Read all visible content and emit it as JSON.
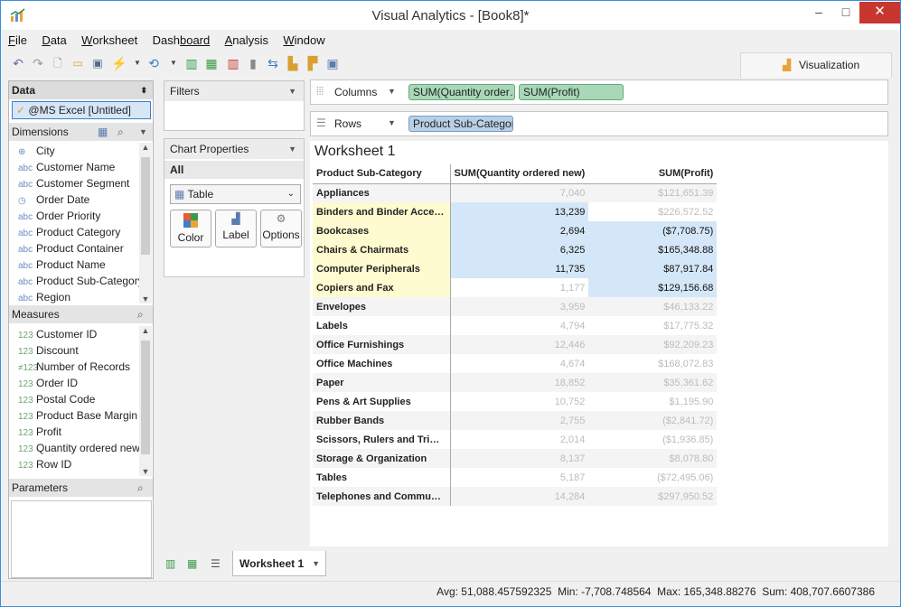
{
  "window": {
    "title": "Visual Analytics - [Book8]*",
    "min": "–",
    "max": "□",
    "close": "✕"
  },
  "menu": [
    {
      "label": "File",
      "key": "F",
      "rest": "ile"
    },
    {
      "label": "Data",
      "key": "D",
      "rest": "ata"
    },
    {
      "label": "Worksheet",
      "key": "W",
      "rest": "orksheet"
    },
    {
      "label": "Dashboard",
      "key": "Dash",
      "rest": "board"
    },
    {
      "label": "Analysis",
      "key": "A",
      "rest": "nalysis"
    },
    {
      "label": "Window",
      "key": "W",
      "rest": "indow"
    }
  ],
  "toolbar": {
    "visualization_tab": "Visualization"
  },
  "data_panel": {
    "header": "Data",
    "datasource": "@MS Excel [Untitled]",
    "dimensions_header": "Dimensions",
    "dimensions": [
      {
        "icon": "globe-icon",
        "glyph": "⊕",
        "label": "City"
      },
      {
        "icon": "abc-icon",
        "glyph": "abc",
        "label": "Customer Name"
      },
      {
        "icon": "abc-icon",
        "glyph": "abc",
        "label": "Customer Segment"
      },
      {
        "icon": "date-icon",
        "glyph": "◷",
        "label": "Order Date"
      },
      {
        "icon": "abc-icon",
        "glyph": "abc",
        "label": "Order Priority"
      },
      {
        "icon": "abc-icon",
        "glyph": "abc",
        "label": "Product Category"
      },
      {
        "icon": "abc-icon",
        "glyph": "abc",
        "label": "Product Container"
      },
      {
        "icon": "abc-icon",
        "glyph": "abc",
        "label": "Product Name"
      },
      {
        "icon": "abc-icon",
        "glyph": "abc",
        "label": "Product Sub-Category"
      },
      {
        "icon": "abc-icon",
        "glyph": "abc",
        "label": "Region"
      }
    ],
    "measures_header": "Measures",
    "measures": [
      {
        "icon": "number-icon",
        "glyph": "123",
        "label": "Customer ID"
      },
      {
        "icon": "number-icon",
        "glyph": "123",
        "label": "Discount"
      },
      {
        "icon": "calc-number-icon",
        "glyph": "≠123",
        "label": "Number of Records"
      },
      {
        "icon": "number-icon",
        "glyph": "123",
        "label": "Order ID"
      },
      {
        "icon": "number-icon",
        "glyph": "123",
        "label": "Postal Code"
      },
      {
        "icon": "number-icon",
        "glyph": "123",
        "label": "Product Base Margin"
      },
      {
        "icon": "number-icon",
        "glyph": "123",
        "label": "Profit"
      },
      {
        "icon": "number-icon",
        "glyph": "123",
        "label": "Quantity ordered new"
      },
      {
        "icon": "number-icon",
        "glyph": "123",
        "label": "Row ID"
      }
    ],
    "parameters_header": "Parameters"
  },
  "filters": {
    "header": "Filters"
  },
  "chart_properties": {
    "header": "Chart Properties",
    "scope": "All",
    "chart_type": "Table",
    "buttons": [
      "Color",
      "Label",
      "Options"
    ]
  },
  "shelves": {
    "columns_label": "Columns",
    "rows_label": "Rows",
    "columns": [
      "SUM(Quantity order…",
      "SUM(Profit)"
    ],
    "rows": [
      "Product Sub-Category"
    ]
  },
  "worksheet": {
    "title": "Worksheet 1",
    "headers": [
      "Product Sub-Category",
      "SUM(Quantity ordered new)",
      "SUM(Profit)"
    ],
    "rows": [
      {
        "cat": "Appliances",
        "qty": "7,040",
        "profit": "$121,651.39",
        "hl_cat": false,
        "hl_qty": false,
        "hl_profit": false
      },
      {
        "cat": "Binders and Binder Access…",
        "qty": "13,239",
        "profit": "$226,572.52",
        "hl_cat": true,
        "hl_qty": true,
        "hl_profit": false
      },
      {
        "cat": "Bookcases",
        "qty": "2,694",
        "profit": "($7,708.75)",
        "hl_cat": true,
        "hl_qty": true,
        "hl_profit": true
      },
      {
        "cat": "Chairs & Chairmats",
        "qty": "6,325",
        "profit": "$165,348.88",
        "hl_cat": true,
        "hl_qty": true,
        "hl_profit": true
      },
      {
        "cat": "Computer Peripherals",
        "qty": "11,735",
        "profit": "$87,917.84",
        "hl_cat": true,
        "hl_qty": true,
        "hl_profit": true
      },
      {
        "cat": "Copiers and Fax",
        "qty": "1,177",
        "profit": "$129,156.68",
        "hl_cat": true,
        "hl_qty": false,
        "hl_profit": true
      },
      {
        "cat": "Envelopes",
        "qty": "3,959",
        "profit": "$46,133.22",
        "hl_cat": false,
        "hl_qty": false,
        "hl_profit": false
      },
      {
        "cat": "Labels",
        "qty": "4,794",
        "profit": "$17,775.32",
        "hl_cat": false,
        "hl_qty": false,
        "hl_profit": false
      },
      {
        "cat": "Office Furnishings",
        "qty": "12,446",
        "profit": "$92,209.23",
        "hl_cat": false,
        "hl_qty": false,
        "hl_profit": false
      },
      {
        "cat": "Office Machines",
        "qty": "4,674",
        "profit": "$168,072.83",
        "hl_cat": false,
        "hl_qty": false,
        "hl_profit": false
      },
      {
        "cat": "Paper",
        "qty": "18,852",
        "profit": "$35,361.62",
        "hl_cat": false,
        "hl_qty": false,
        "hl_profit": false
      },
      {
        "cat": "Pens & Art Supplies",
        "qty": "10,752",
        "profit": "$1,195.90",
        "hl_cat": false,
        "hl_qty": false,
        "hl_profit": false
      },
      {
        "cat": "Rubber Bands",
        "qty": "2,755",
        "profit": "($2,841.72)",
        "hl_cat": false,
        "hl_qty": false,
        "hl_profit": false
      },
      {
        "cat": "Scissors, Rulers and Trimm…",
        "qty": "2,014",
        "profit": "($1,936.85)",
        "hl_cat": false,
        "hl_qty": false,
        "hl_profit": false
      },
      {
        "cat": "Storage & Organization",
        "qty": "8,137",
        "profit": "$8,078.80",
        "hl_cat": false,
        "hl_qty": false,
        "hl_profit": false
      },
      {
        "cat": "Tables",
        "qty": "5,187",
        "profit": "($72,495.06)",
        "hl_cat": false,
        "hl_qty": false,
        "hl_profit": false
      },
      {
        "cat": "Telephones and Communica…",
        "qty": "14,284",
        "profit": "$297,950.52",
        "hl_cat": false,
        "hl_qty": false,
        "hl_profit": false
      }
    ]
  },
  "sheet_tabs": [
    "Worksheet 1"
  ],
  "status": "Avg: 51,088.457592325  Min: -7,708.748564  Max: 165,348.88276  Sum: 408,707.6607386"
}
